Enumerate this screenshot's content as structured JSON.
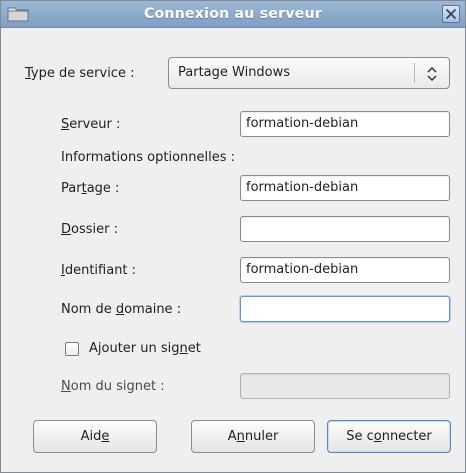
{
  "window": {
    "title": "Connexion au serveur",
    "icons": {
      "window": "folder-icon",
      "close": "close-icon"
    }
  },
  "service_type": {
    "label_mnemonic": "T",
    "label_rest": "ype de service :",
    "selected": "Partage Windows"
  },
  "server": {
    "label_mnemonic": "S",
    "label_rest": "erveur :",
    "value": "formation-debian"
  },
  "optional_heading": "Informations optionnelles :",
  "share": {
    "label_pre": "Par",
    "label_mnemonic": "t",
    "label_rest": "age :",
    "value": "formation-debian"
  },
  "folder": {
    "label_mnemonic": "D",
    "label_rest": "ossier :",
    "value": ""
  },
  "username": {
    "label_mnemonic": "I",
    "label_rest": "dentifiant :",
    "value": "formation-debian"
  },
  "domain": {
    "label_pre": "Nom de ",
    "label_mnemonic": "d",
    "label_rest": "omaine :",
    "value": ""
  },
  "bookmark_checkbox": {
    "label_pre": "Ajouter un sig",
    "label_mnemonic": "n",
    "label_rest": "et",
    "checked": false
  },
  "bookmark_name": {
    "label_mnemonic": "N",
    "label_rest": "om du signet :",
    "value": ""
  },
  "buttons": {
    "help": {
      "pre": "Aid",
      "mnemonic": "e",
      "rest": ""
    },
    "cancel": {
      "pre": "A",
      "mnemonic": "n",
      "rest": "nuler"
    },
    "connect": {
      "pre": "Se c",
      "mnemonic": "o",
      "rest": "nnecter"
    }
  },
  "colors": {
    "titlebar": "#8aaacd",
    "focus": "#6a8fc6",
    "dialog_bg": "#efefef"
  }
}
